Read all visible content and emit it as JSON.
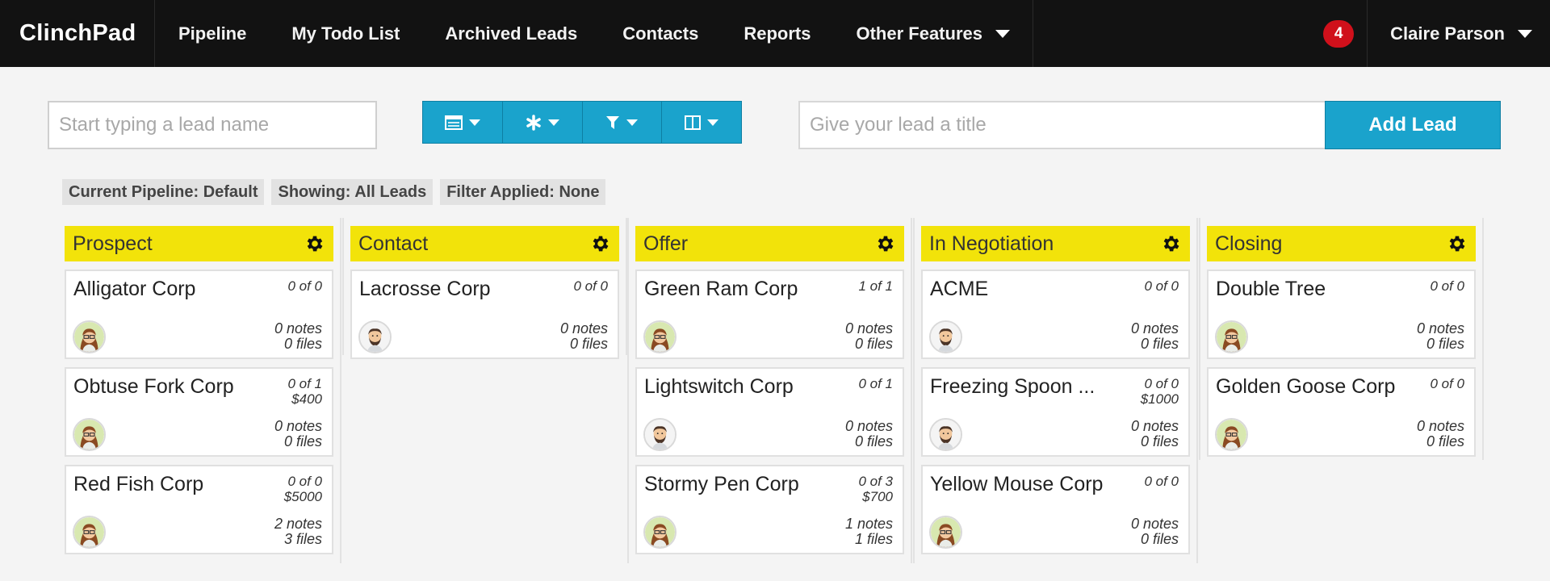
{
  "app": {
    "brand": "ClinchPad",
    "nav": [
      "Pipeline",
      "My Todo List",
      "Archived Leads",
      "Contacts",
      "Reports"
    ],
    "other_features": "Other Features",
    "notification_count": "4",
    "user_name": "Claire Parson"
  },
  "toolbar": {
    "search_placeholder": "Start typing a lead name",
    "title_placeholder": "Give your lead a title",
    "add_lead": "Add Lead",
    "icons": [
      "list-view-icon",
      "asterisk-icon",
      "filter-icon",
      "columns-icon"
    ]
  },
  "filters": {
    "pipeline": "Current Pipeline: Default",
    "showing": "Showing: All Leads",
    "filter": "Filter Applied: None"
  },
  "colors": {
    "nav_bg": "#121212",
    "accent": "#1aa3cc",
    "column_header": "#f2e30a",
    "badge": "#d0101b"
  },
  "columns": [
    {
      "title": "Prospect",
      "cards": [
        {
          "name": "Alligator Corp",
          "count": "0 of 0",
          "amount": "",
          "notes": "0 notes",
          "files": "0 files",
          "avatar": "female-avatar"
        },
        {
          "name": "Obtuse Fork Corp",
          "count": "0 of 1",
          "amount": "$400",
          "notes": "0 notes",
          "files": "0 files",
          "avatar": "female-avatar"
        },
        {
          "name": "Red Fish Corp",
          "count": "0 of 0",
          "amount": "$5000",
          "notes": "2 notes",
          "files": "3 files",
          "avatar": "female-avatar"
        }
      ]
    },
    {
      "title": "Contact",
      "cards": [
        {
          "name": "Lacrosse Corp",
          "count": "0 of 0",
          "amount": "",
          "notes": "0 notes",
          "files": "0 files",
          "avatar": "male-avatar"
        }
      ]
    },
    {
      "title": "Offer",
      "cards": [
        {
          "name": "Green Ram Corp",
          "count": "1 of 1",
          "amount": "",
          "notes": "0 notes",
          "files": "0 files",
          "avatar": "female-avatar"
        },
        {
          "name": "Lightswitch Corp",
          "count": "0 of 1",
          "amount": "",
          "notes": "0 notes",
          "files": "0 files",
          "avatar": "male-avatar"
        },
        {
          "name": "Stormy Pen Corp",
          "count": "0 of 3",
          "amount": "$700",
          "notes": "1 notes",
          "files": "1 files",
          "avatar": "female-avatar"
        }
      ]
    },
    {
      "title": "In Negotiation",
      "cards": [
        {
          "name": "ACME",
          "count": "0 of 0",
          "amount": "",
          "notes": "0 notes",
          "files": "0 files",
          "avatar": "male-avatar"
        },
        {
          "name": "Freezing Spoon ...",
          "count": "0 of 0",
          "amount": "$1000",
          "notes": "0 notes",
          "files": "0 files",
          "avatar": "male-avatar"
        },
        {
          "name": "Yellow Mouse Corp",
          "count": "0 of 0",
          "amount": "",
          "notes": "0 notes",
          "files": "0 files",
          "avatar": "female-avatar"
        }
      ]
    },
    {
      "title": "Closing",
      "cards": [
        {
          "name": "Double Tree",
          "count": "0 of 0",
          "amount": "",
          "notes": "0 notes",
          "files": "0 files",
          "avatar": "female-avatar"
        },
        {
          "name": "Golden Goose Corp",
          "count": "0 of 0",
          "amount": "",
          "notes": "0 notes",
          "files": "0 files",
          "avatar": "female-avatar"
        }
      ]
    }
  ]
}
